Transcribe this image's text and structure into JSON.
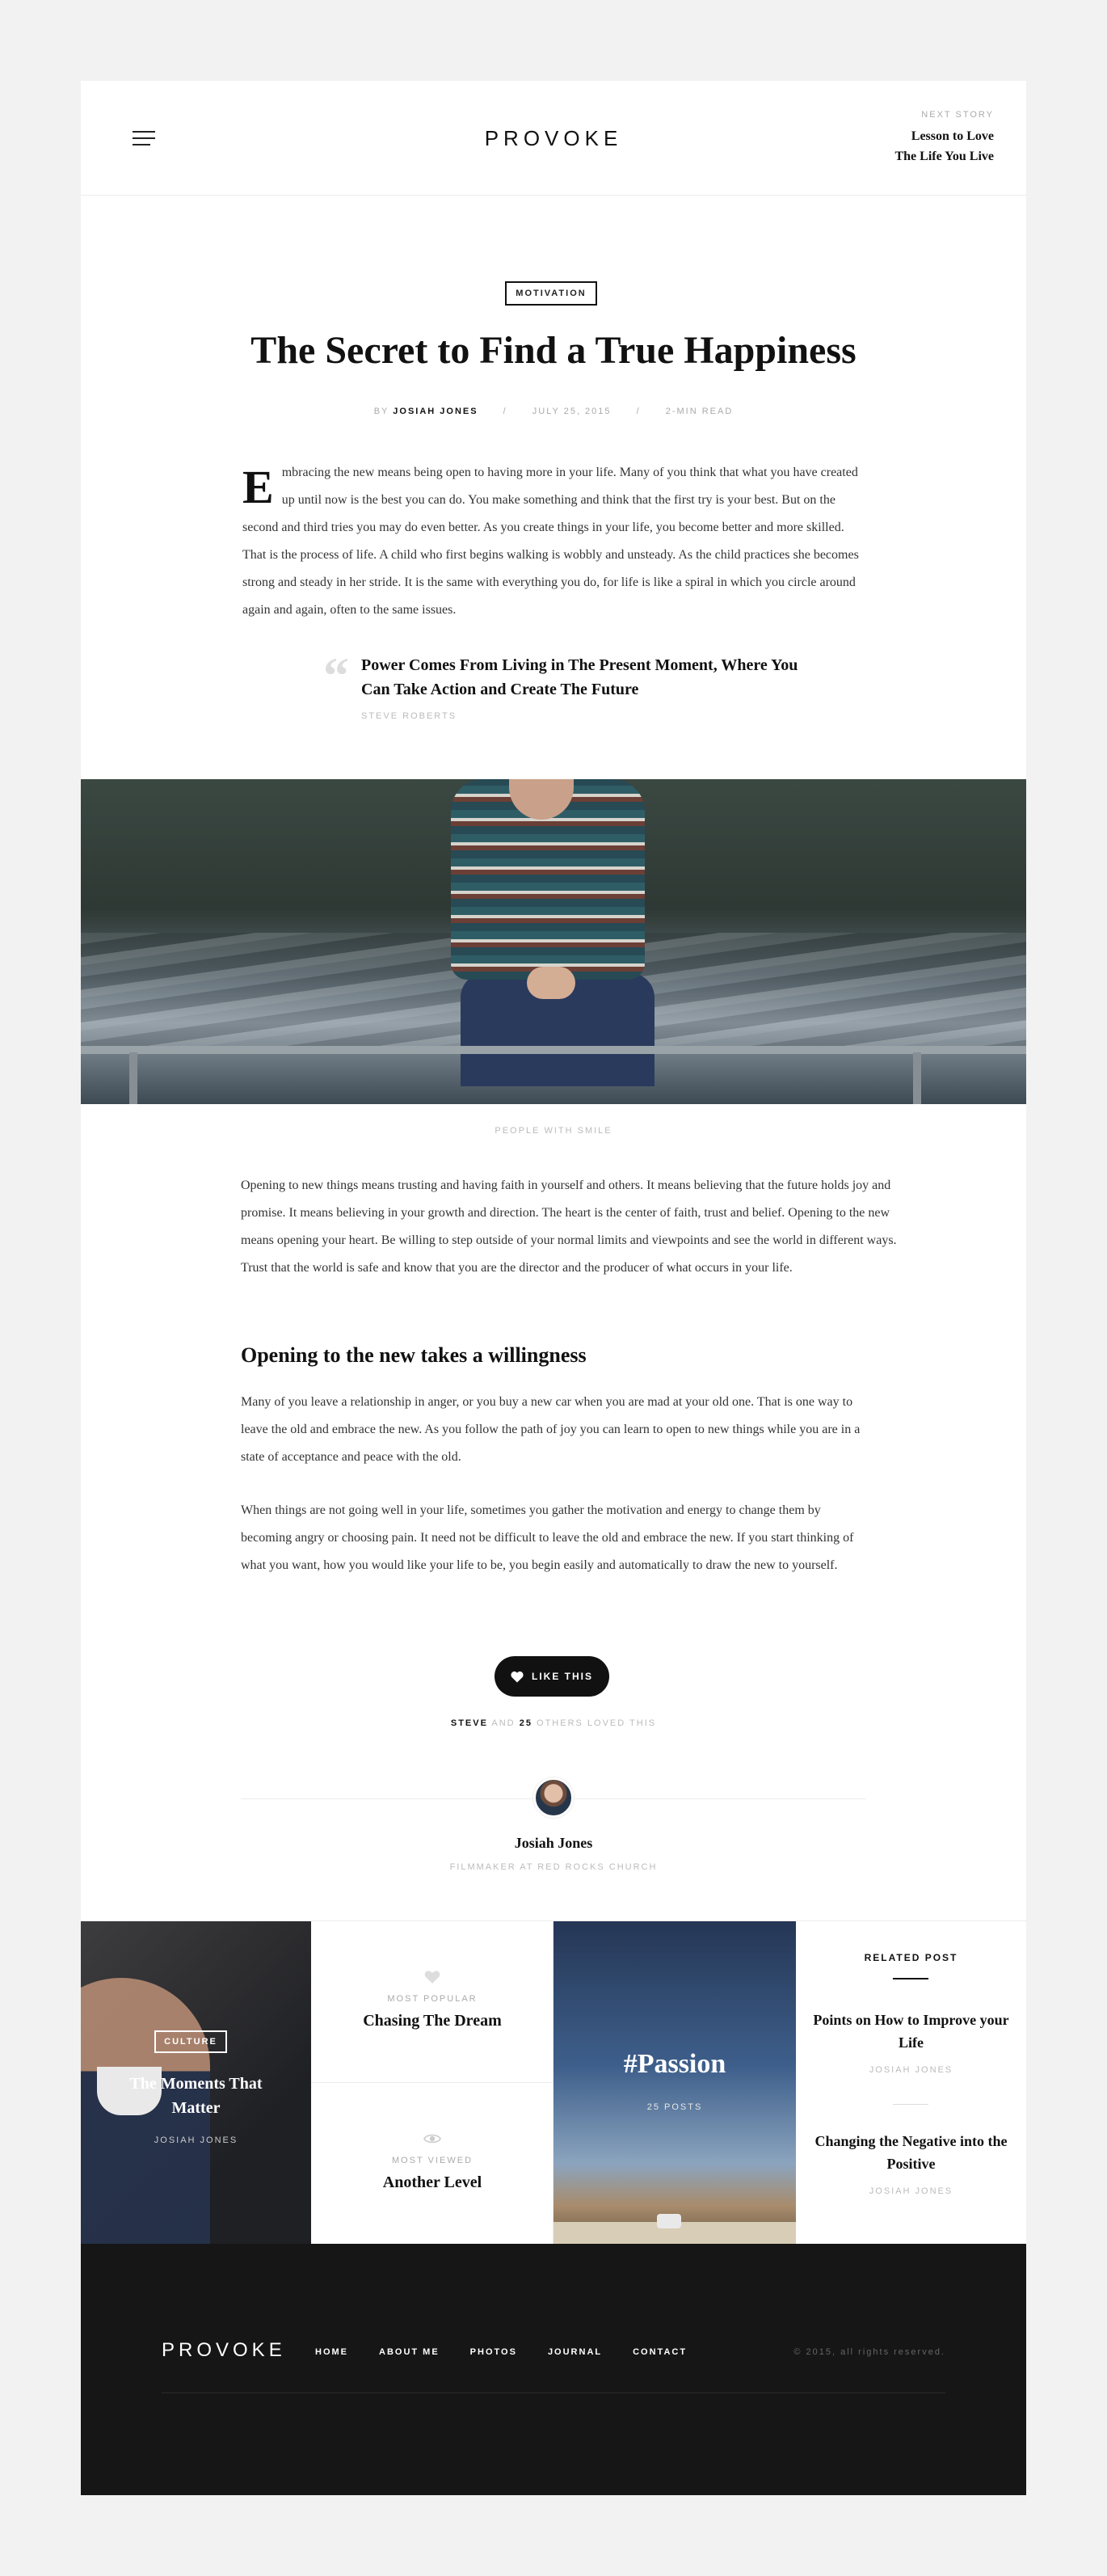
{
  "header": {
    "logo": "PROVOKE",
    "next_story": {
      "eyebrow": "NEXT STORY",
      "title_line1": "Lesson to Love",
      "title_line2": "The Life You Live"
    }
  },
  "article": {
    "category": "MOTIVATION",
    "title": "The Secret to Find a True Happiness",
    "meta": {
      "by": "BY",
      "author": "JOSIAH JONES",
      "date": "JULY 25, 2015",
      "read_time": "2-MIN READ"
    },
    "dropcap": "E",
    "intro": "mbracing the new means being open to having more in your life. Many of you think that what you have created up until now is the best you can do. You make something and think that the first try is your best. But on the second and third tries you may do even better. As you create things in your life, you become better and more skilled. That is the process of life. A child who first begins walking is wobbly and unsteady. As the child practices she becomes strong and steady in her stride. It is the same with everything you do, for life is like a spiral in which you circle around again and again, often to the same issues.",
    "quote": {
      "mark": "“",
      "text": "Power Comes From Living in The Present Moment, Where You Can Take Action and Create The Future",
      "author": "STEVE ROBERTS"
    },
    "image_caption": "PEOPLE WITH SMILE",
    "para2": "Opening to new things means trusting and having faith in yourself and others. It means believing that the future holds joy and promise. It means believing in your growth and direction. The heart is the center of faith, trust and belief. Opening to the new means opening your heart. Be willing to step outside of your normal limits and viewpoints and see the world in different ways. Trust that the world is safe and know that you are the director and the producer of what occurs in your life.",
    "subheading": "Opening to the new takes a willingness",
    "para3": "Many of you leave a relationship in anger, or you buy a new car when you are mad at your old one. That is one way to leave the old and embrace the new. As you follow the path of joy you can learn to open to new things while you are in a state of acceptance and peace with the old.",
    "para4": "When things are not going well in your life, sometimes you gather the motivation and energy to change them by becoming angry or choosing pain. It need not be difficult to leave the old and embrace the new. If you start thinking of what you want, how you would like your life to be, you begin easily and automatically to draw the new to yourself.",
    "like_label": "LIKE THIS",
    "loved": {
      "name": "STEVE",
      "and": "AND",
      "count": "25",
      "rest": "OTHERS LOVED THIS"
    },
    "author_box": {
      "name": "Josiah Jones",
      "role": "FILMMAKER AT RED ROCKS CHURCH"
    }
  },
  "related": {
    "culture": {
      "badge": "CULTURE",
      "title": "The Moments That Matter",
      "author": "JOSIAH JONES"
    },
    "most_popular": {
      "eyebrow": "MOST POPULAR",
      "title": "Chasing The Dream",
      "icon": "heart-icon"
    },
    "most_viewed": {
      "eyebrow": "MOST VIEWED",
      "title": "Another Level",
      "icon": "eye-icon"
    },
    "passion": {
      "title": "#Passion",
      "count": "25 POSTS"
    },
    "related_post": {
      "heading": "RELATED POST",
      "items": [
        {
          "title": "Points on How to Improve your Life",
          "author": "JOSIAH JONES"
        },
        {
          "title": "Changing the Negative into the Positive",
          "author": "JOSIAH JONES"
        }
      ]
    }
  },
  "footer": {
    "logo": "PROVOKE",
    "nav": [
      "HOME",
      "ABOUT ME",
      "PHOTOS",
      "JOURNAL",
      "CONTACT"
    ],
    "copyright": "© 2015, all rights reserved."
  },
  "colors": {
    "background": "#f2f2f2",
    "ink": "#111111",
    "footer": "#161616",
    "muted": "#aaaaaa"
  }
}
